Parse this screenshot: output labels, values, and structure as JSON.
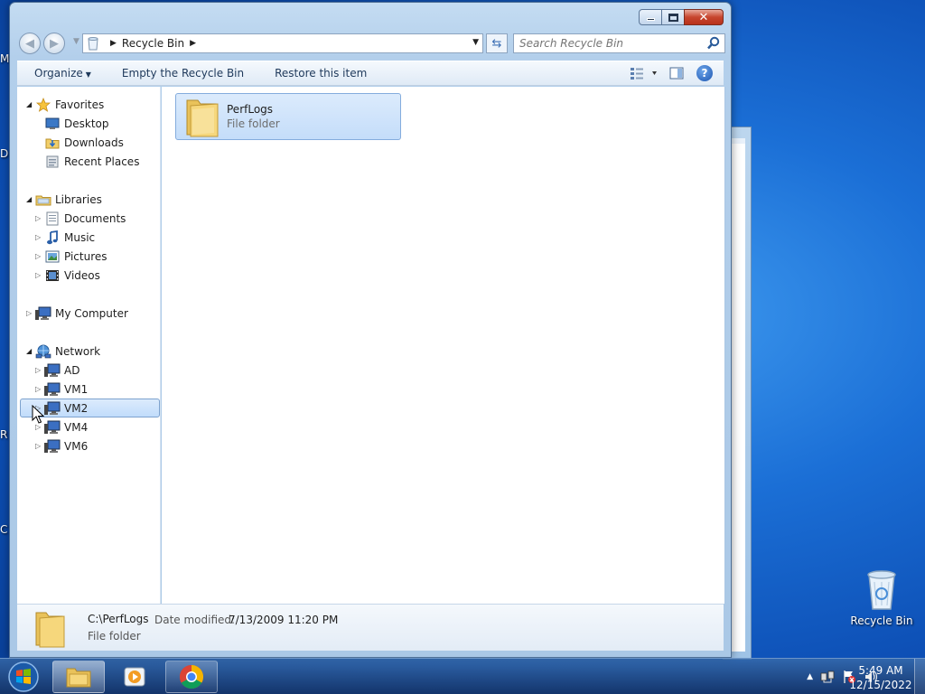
{
  "window": {
    "breadcrumb": "Recycle Bin",
    "search_placeholder": "Search Recycle Bin"
  },
  "toolbar": {
    "organize": "Organize",
    "empty_bin": "Empty the Recycle Bin",
    "restore": "Restore this item"
  },
  "nav": {
    "favorites": "Favorites",
    "desktop": "Desktop",
    "downloads": "Downloads",
    "recent_places": "Recent Places",
    "libraries": "Libraries",
    "documents": "Documents",
    "music": "Music",
    "pictures": "Pictures",
    "videos": "Videos",
    "my_computer": "My Computer",
    "network": "Network",
    "ad": "AD",
    "vm1": "VM1",
    "vm2": "VM2",
    "vm4": "VM4",
    "vm6": "VM6"
  },
  "content": {
    "item_name": "PerfLogs",
    "item_type": "File folder"
  },
  "details": {
    "path": "C:\\PerfLogs",
    "modified_label": "Date modified:",
    "modified_value": "7/13/2009 11:20 PM",
    "type": "File folder"
  },
  "desktop": {
    "recycle_bin_label": "Recycle Bin",
    "edge_letters": [
      "M",
      "D",
      "R",
      "C"
    ]
  },
  "taskbar": {
    "time": "5:49 AM",
    "date": "12/15/2022"
  },
  "colors": {
    "selection": "#c4ddfa",
    "accent": "#1d56b1"
  }
}
